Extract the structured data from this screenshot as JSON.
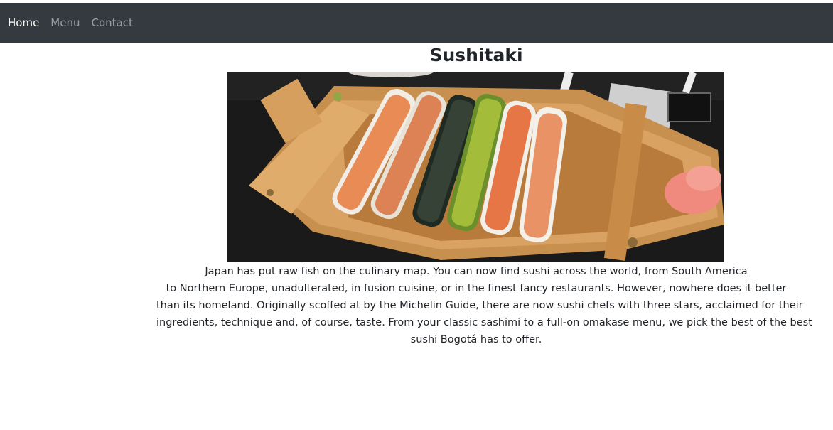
{
  "nav": {
    "items": [
      {
        "label": "Home",
        "active": true
      },
      {
        "label": "Menu",
        "active": false
      },
      {
        "label": "Contact",
        "active": false
      }
    ]
  },
  "page": {
    "title": "Sushitaki",
    "hero_image_icon": "sushi-boat-photo",
    "intro_lines": [
      "Japan has put raw fish on the culinary map. You can now find sushi across the world, from South America",
      "to Northern Europe, unadulterated, in fusion cuisine, or in the finest fancy restaurants. However, nowhere does it better",
      "than its homeland. Originally scoffed at by the Michelin Guide, there are now sushi chefs with three stars, acclaimed for their",
      "ingredients, technique and, of course, taste. From your classic sashimi to a full-on omakase menu, we pick the best of the best",
      "sushi Bogotá has to offer."
    ]
  },
  "colors": {
    "navbar_bg": "#343a40",
    "nav_active": "#ffffff",
    "nav_inactive": "rgba(255,255,255,0.5)"
  }
}
